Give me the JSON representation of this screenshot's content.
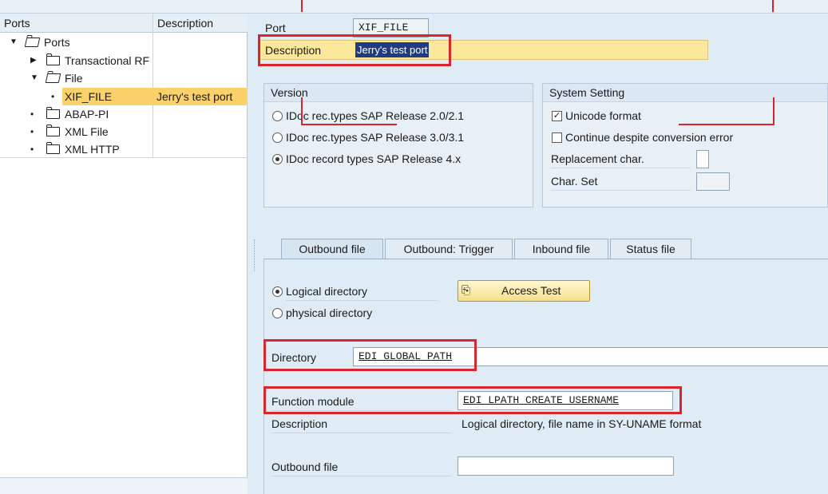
{
  "tree": {
    "headers": {
      "ports": "Ports",
      "description": "Description"
    },
    "rows": [
      {
        "label": "Ports",
        "desc": "",
        "level": 0,
        "kind": "open-folder",
        "expanded": true
      },
      {
        "label": "Transactional RF",
        "desc": "",
        "level": 1,
        "kind": "folder",
        "expanded": false
      },
      {
        "label": "File",
        "desc": "",
        "level": 1,
        "kind": "open-folder",
        "expanded": true
      },
      {
        "label": "XIF_FILE",
        "desc": "Jerry's test port",
        "level": 2,
        "kind": "leaf",
        "selected": true
      },
      {
        "label": "ABAP-PI",
        "desc": "",
        "level": 1,
        "kind": "folder-leaf"
      },
      {
        "label": "XML File",
        "desc": "",
        "level": 1,
        "kind": "folder-leaf"
      },
      {
        "label": "XML HTTP",
        "desc": "",
        "level": 1,
        "kind": "folder-leaf"
      }
    ]
  },
  "port": {
    "label": "Port",
    "value": "XIF_FILE"
  },
  "description": {
    "label": "Description",
    "value": "Jerry's test port"
  },
  "version": {
    "title": "Version",
    "options": [
      {
        "label": "IDoc rec.types SAP Release 2.0/2.1",
        "selected": false
      },
      {
        "label": "IDoc rec.types SAP Release 3.0/3.1",
        "selected": false
      },
      {
        "label": "IDoc record types SAP Release 4.x",
        "selected": true
      }
    ]
  },
  "system_setting": {
    "title": "System Setting",
    "unicode": {
      "label": "Unicode format",
      "checked": true
    },
    "continue": {
      "label": "Continue despite conversion error",
      "checked": false
    },
    "replacement_label": "Replacement char.",
    "charset_label": "Char. Set"
  },
  "tabs": [
    {
      "label": "Outbound file",
      "active": true
    },
    {
      "label": "Outbound: Trigger",
      "active": false
    },
    {
      "label": "Inbound file",
      "active": false
    },
    {
      "label": "Status file",
      "active": false
    }
  ],
  "outbound": {
    "logical_dir": {
      "label": "Logical directory",
      "selected": true
    },
    "physical_dir": {
      "label": "physical directory",
      "selected": false
    },
    "access_test": "Access Test",
    "directory": {
      "label": "Directory",
      "value": "EDI_GLOBAL_PATH"
    },
    "function_module": {
      "label": "Function module",
      "value": "EDI_LPATH_CREATE_USERNAME"
    },
    "description": {
      "label": "Description",
      "value": "Logical directory, file name in SY-UNAME format"
    },
    "outbound_file": {
      "label": "Outbound file",
      "value": ""
    }
  },
  "colors": {
    "highlight_red": "#d7262e",
    "selection_yellow": "#fbd16b",
    "field_yellow": "#fde79a",
    "background": "#dfebf5"
  }
}
